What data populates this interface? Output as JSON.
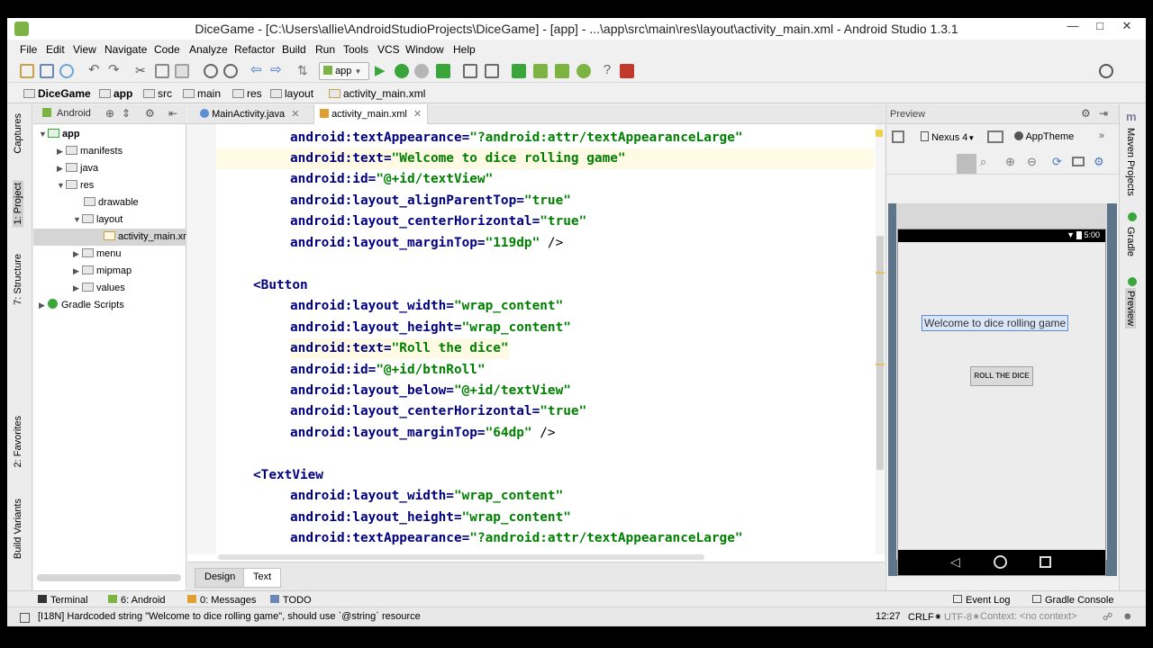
{
  "window": {
    "title": "DiceGame - [C:\\Users\\allie\\AndroidStudioProjects\\DiceGame] - [app] - ...\\app\\src\\main\\res\\layout\\activity_main.xml - Android Studio 1.3.1"
  },
  "menu": [
    "File",
    "Edit",
    "View",
    "Navigate",
    "Code",
    "Analyze",
    "Refactor",
    "Build",
    "Run",
    "Tools",
    "VCS",
    "Window",
    "Help"
  ],
  "toolbar": {
    "run_config": "app"
  },
  "breadcrumb": [
    "DiceGame",
    "app",
    "src",
    "main",
    "res",
    "layout",
    "activity_main.xml"
  ],
  "left_tabs": [
    "1: Project",
    "Captures",
    "7: Structure",
    "2: Favorites",
    "Build Variants"
  ],
  "project": {
    "view_mode": "Android",
    "tree": [
      {
        "label": "app",
        "expanded": true
      },
      {
        "label": "manifests"
      },
      {
        "label": "java"
      },
      {
        "label": "res",
        "expanded": true
      },
      {
        "label": "drawable"
      },
      {
        "label": "layout",
        "expanded": true
      },
      {
        "label": "activity_main.xml"
      },
      {
        "label": "menu"
      },
      {
        "label": "mipmap"
      },
      {
        "label": "values"
      },
      {
        "label": "Gradle Scripts"
      }
    ]
  },
  "editor": {
    "tabs": [
      "MainActivity.java",
      "activity_main.xml"
    ],
    "lines": [
      {
        "attr": "android:textAppearance=",
        "val": "\"?android:attr/textAppearanceLarge\"",
        "tail": ""
      },
      {
        "attr": "android:text=",
        "val": "\"Welcome to dice rolling game\"",
        "tail": ""
      },
      {
        "attr": "android:id=",
        "val": "\"@+id/textView\"",
        "tail": ""
      },
      {
        "attr": "android:layout_alignParentTop=",
        "val": "\"true\"",
        "tail": ""
      },
      {
        "attr": "android:layout_centerHorizontal=",
        "val": "\"true\"",
        "tail": ""
      },
      {
        "attr": "android:layout_marginTop=",
        "val": "\"119dp\"",
        "tail": " />"
      },
      {
        "tag": "<Button"
      },
      {
        "attr": "android:layout_width=",
        "val": "\"wrap_content\"",
        "tail": ""
      },
      {
        "attr": "android:layout_height=",
        "val": "\"wrap_content\"",
        "tail": ""
      },
      {
        "attr": "android:text=",
        "val": "\"Roll the dice\"",
        "tail": ""
      },
      {
        "attr": "android:id=",
        "val": "\"@+id/btnRoll\"",
        "tail": ""
      },
      {
        "attr": "android:layout_below=",
        "val": "\"@+id/textView\"",
        "tail": ""
      },
      {
        "attr": "android:layout_centerHorizontal=",
        "val": "\"true\"",
        "tail": ""
      },
      {
        "attr": "android:layout_marginTop=",
        "val": "\"64dp\"",
        "tail": " />"
      },
      {
        "tag": "<TextView"
      },
      {
        "attr": "android:layout_width=",
        "val": "\"wrap_content\"",
        "tail": ""
      },
      {
        "attr": "android:layout_height=",
        "val": "\"wrap_content\"",
        "tail": ""
      },
      {
        "attr": "android:textAppearance=",
        "val": "\"?android:attr/textAppearanceLarge\"",
        "tail": ""
      }
    ],
    "bottom_tabs": [
      "Design",
      "Text"
    ]
  },
  "preview": {
    "label": "Preview",
    "device": "Nexus 4",
    "theme": "AppTheme",
    "status_time": "5:00",
    "text_view": "Welcome to dice rolling game",
    "button": "ROLL THE DICE"
  },
  "right_tabs": [
    "Maven Projects",
    "Gradle",
    "Preview"
  ],
  "bottom_tools": [
    "Terminal",
    "6: Android",
    "0: Messages",
    "TODO",
    "Event Log",
    "Gradle Console"
  ],
  "status": {
    "message": "[I18N] Hardcoded string \"Welcome to dice rolling game\", should use `@string` resource",
    "position": "12:27",
    "line_sep": "CRLF⁕",
    "encoding": "UTF-8⁕",
    "context": "Context: <no context>"
  }
}
